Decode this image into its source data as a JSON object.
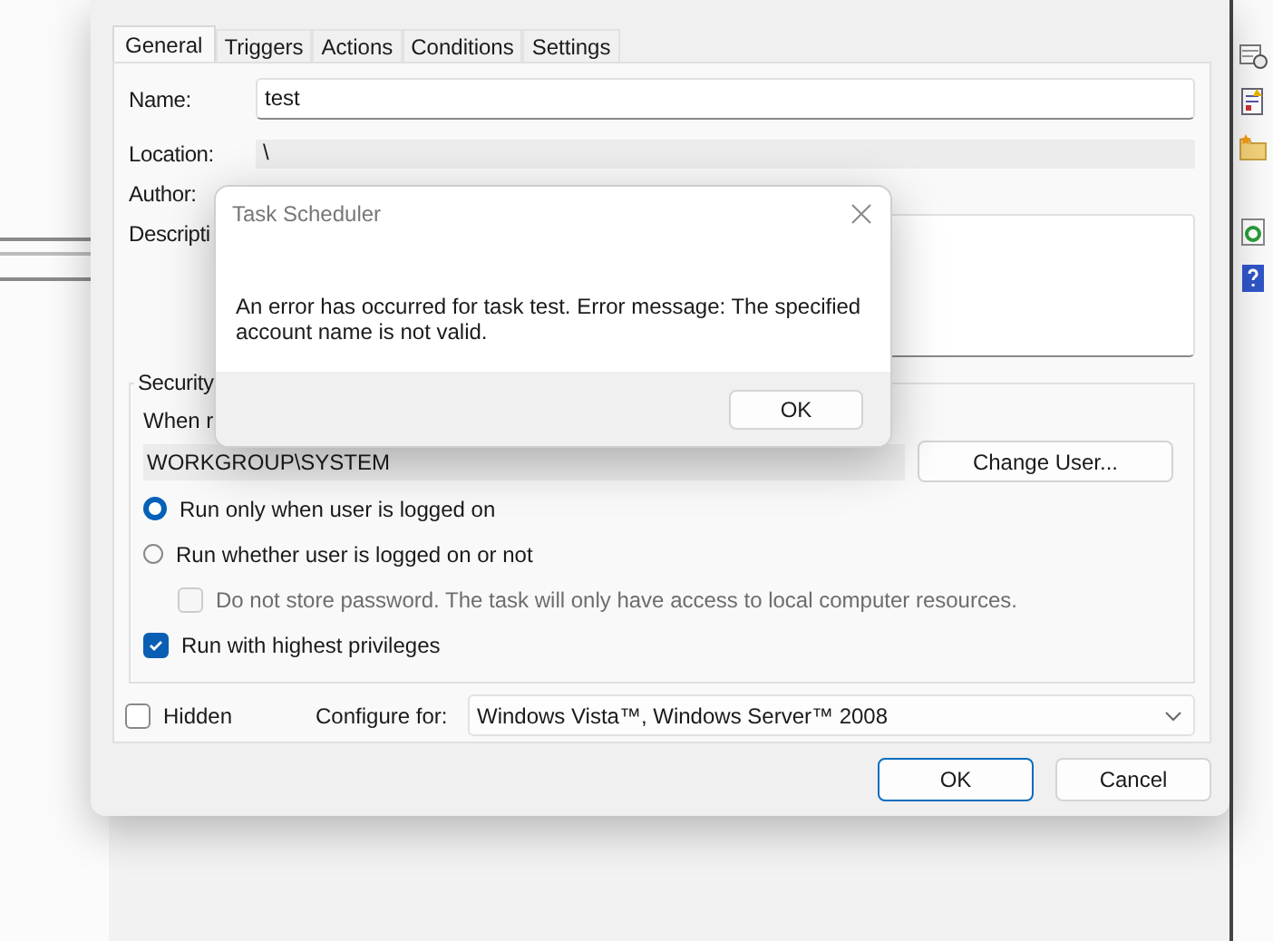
{
  "properties_dialog": {
    "tabs": [
      {
        "label": "General",
        "selected": true
      },
      {
        "label": "Triggers",
        "selected": false
      },
      {
        "label": "Actions",
        "selected": false
      },
      {
        "label": "Conditions",
        "selected": false
      },
      {
        "label": "Settings",
        "selected": false
      }
    ],
    "fields": [
      {
        "kind": "input",
        "label": "Name:",
        "value": "test"
      },
      {
        "kind": "readonly",
        "label": "Location:",
        "value": "\\"
      },
      {
        "kind": "text",
        "label": "Author:"
      },
      {
        "kind": "textarea",
        "label": "Descripti"
      }
    ],
    "security": {
      "title": "Security",
      "prompt": "When r",
      "user": "WORKGROUP\\SYSTEM",
      "change_user_button": "Change User...",
      "options": [
        {
          "kind": "radio",
          "label": "Run only when user is logged on",
          "selected": true
        },
        {
          "kind": "radio",
          "label": "Run whether user is logged on or not",
          "selected": false,
          "children": [
            {
              "kind": "checkbox",
              "label": "Do not store password.  The task will only have access to local computer resources.",
              "checked": false,
              "disabled": true
            }
          ]
        },
        {
          "kind": "checkbox",
          "label": "Run with highest privileges",
          "checked": true,
          "disabled": false
        }
      ]
    },
    "hidden": {
      "label": "Hidden",
      "checked": false
    },
    "configure_for": {
      "label": "Configure for:",
      "value": "Windows Vista™, Windows Server™ 2008"
    },
    "buttons": [
      {
        "label": "OK",
        "default": true
      },
      {
        "label": "Cancel",
        "default": false
      }
    ]
  },
  "error_dialog": {
    "title": "Task Scheduler",
    "message": "An error has occurred for task test. Error message: The specified account name is not valid.",
    "buttons": [
      "OK"
    ]
  }
}
